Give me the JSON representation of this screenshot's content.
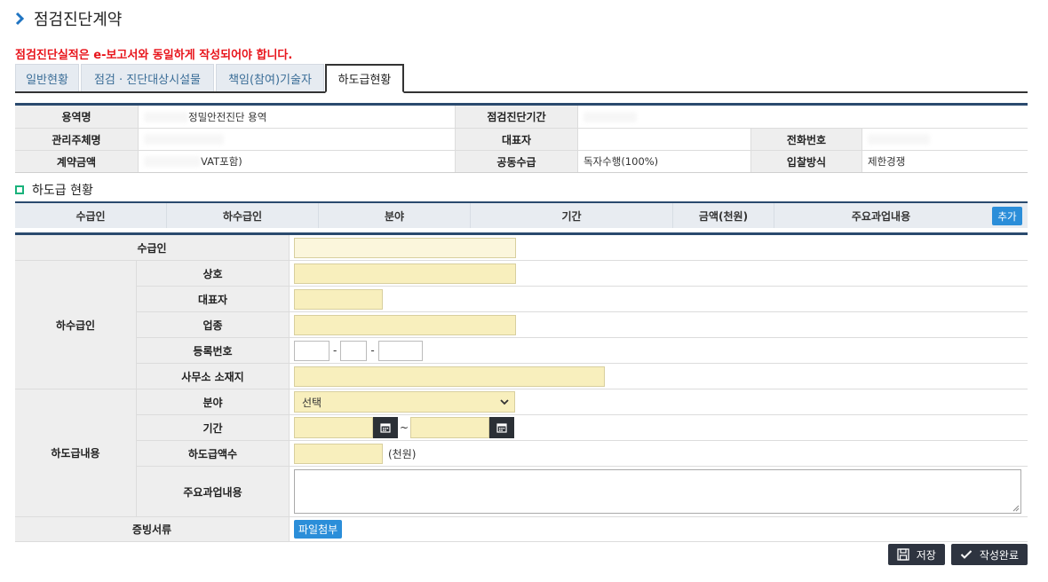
{
  "page": {
    "title": "점검진단계약",
    "notice": "점검진단실적은 e-보고서와 동일하게 작성되어야 합니다."
  },
  "tabs": [
    "일반현황",
    "점검 · 진단대상시설물",
    "책임(참여)기술자",
    "하도급현황"
  ],
  "info": {
    "service_name_label": "용역명",
    "service_name_value": "정밀안전진단 용역",
    "period_label": "점검진단기간",
    "manager_label": "관리주체명",
    "rep_label": "대표자",
    "phone_label": "전화번호",
    "contract_amount_label": "계약금액",
    "contract_amount_value": "VAT포함)",
    "joint_label": "공동수급",
    "joint_value": "독자수행(100%)",
    "bidding_label": "입찰방식",
    "bidding_value": "제한경쟁"
  },
  "section": {
    "title": "하도급 현황"
  },
  "subcontract_table": {
    "columns": [
      "수급인",
      "하수급인",
      "분야",
      "기간",
      "금액(천원)",
      "주요과업내용"
    ],
    "add_label": "추가"
  },
  "form": {
    "contractor_label": "수급인",
    "subcontractor_group": "하수급인",
    "company_label": "상호",
    "rep_label": "대표자",
    "business_label": "업종",
    "regno_label": "등록번호",
    "regno_sep": "-",
    "office_label": "사무소 소재지",
    "content_group": "하도급내용",
    "field_label": "분야",
    "field_value": "선택",
    "period_label": "기간",
    "period_sep": "~",
    "amount_label": "하도급액수",
    "amount_unit": "(천원)",
    "tasks_label": "주요과업내용",
    "evidence_label": "증빙서류",
    "file_button": "파일첨부"
  },
  "buttons": {
    "save": "저장",
    "complete": "작성완료"
  }
}
